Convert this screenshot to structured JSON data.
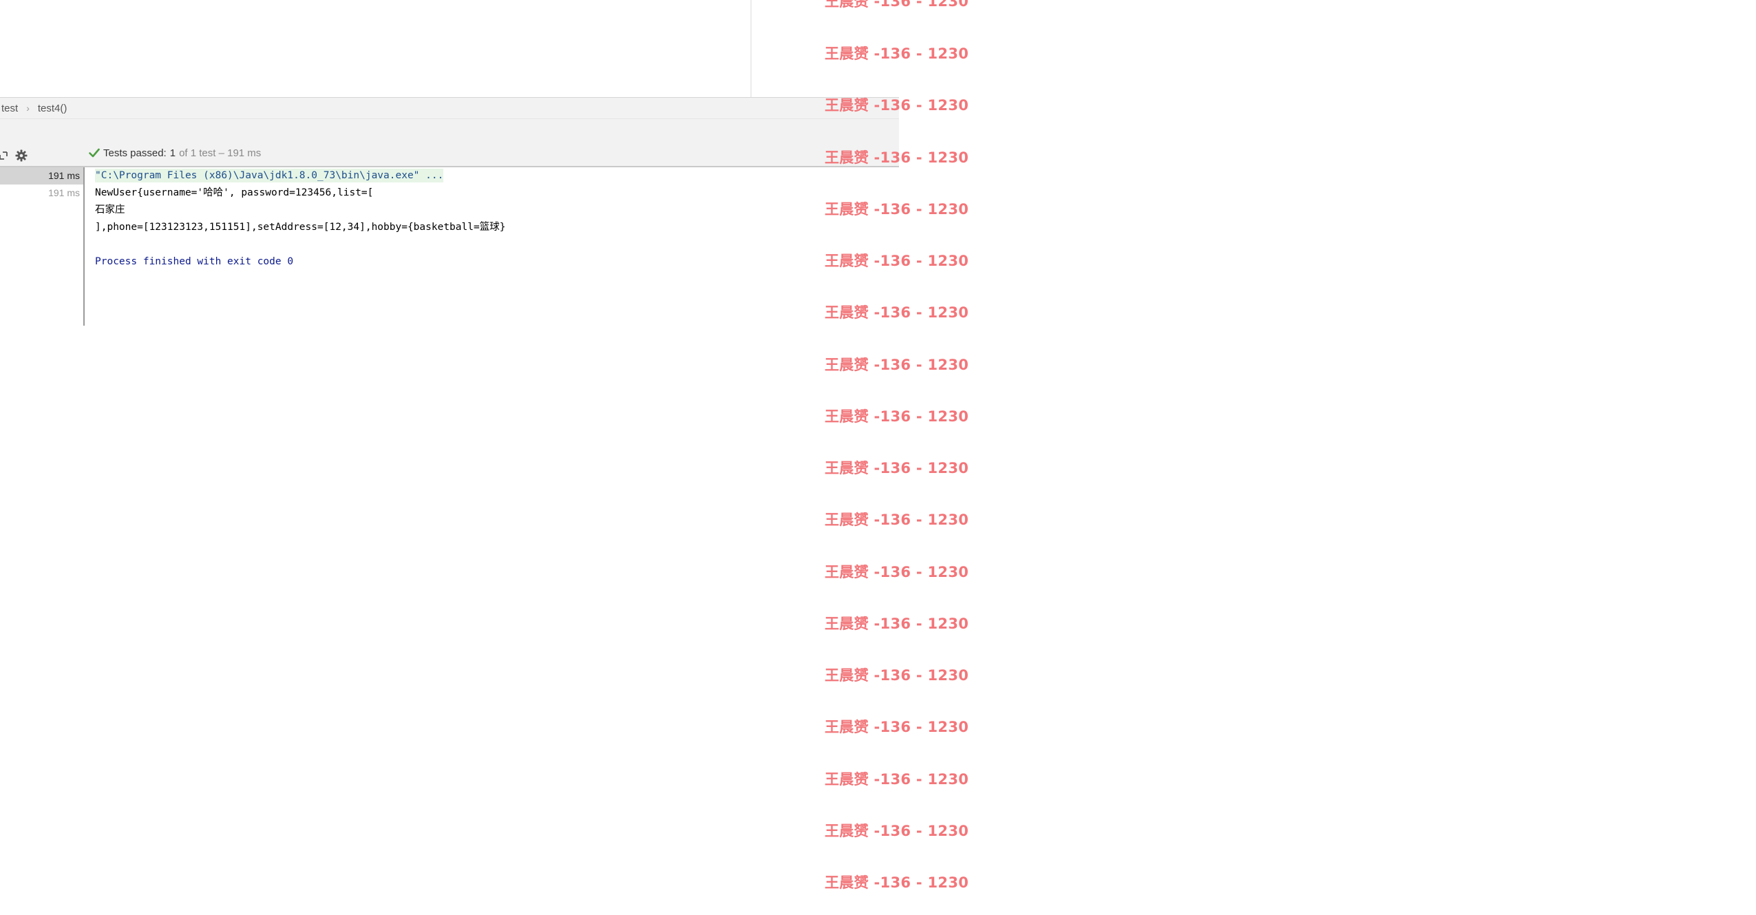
{
  "breadcrumb": {
    "items": [
      "test",
      "test4()"
    ],
    "separator": "›"
  },
  "test_status": {
    "label": "Tests passed:",
    "passed_count": "1",
    "detail": "of 1 test – 191 ms",
    "color": "#4a9e3f"
  },
  "run_gutter": {
    "rows": [
      "191 ms",
      "191 ms"
    ]
  },
  "console": {
    "lines": [
      "\"C:\\Program Files (x86)\\Java\\jdk1.8.0_73\\bin\\java.exe\" ...",
      "NewUser{username='哈哈', password=123456,list=[",
      "石家庄",
      "],phone=[123123123,151151],setAddress=[12,34],hobby={basketball=篮球}",
      "",
      "Process finished with exit code 0"
    ]
  },
  "watermark": {
    "text": "王晨赟 -136 - 1230",
    "color": "#f2767a"
  }
}
